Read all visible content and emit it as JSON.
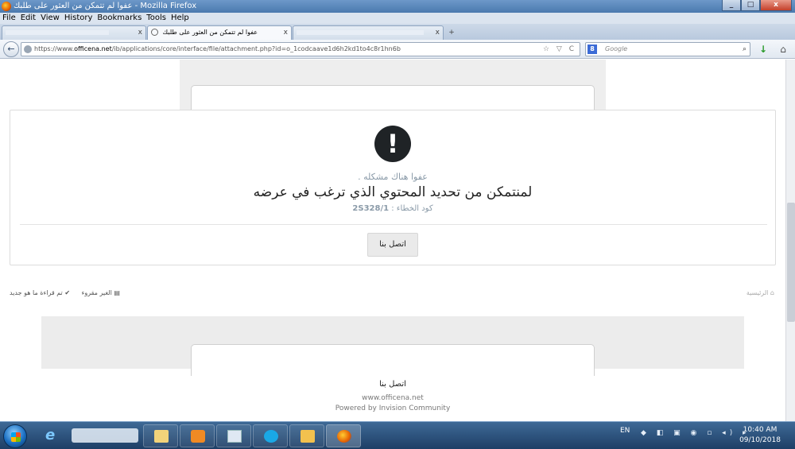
{
  "window": {
    "title": "عفوا لم تتمكن من العثور على طلبك - Mozilla Firefox",
    "controls": [
      "_",
      "□",
      "x"
    ]
  },
  "menu": [
    "File",
    "Edit",
    "View",
    "History",
    "Bookmarks",
    "Tools",
    "Help"
  ],
  "tabs": [
    {
      "label": ""
    },
    {
      "label": "عفوا لم تتمكن من العثور على طلبك"
    },
    {
      "label": ""
    }
  ],
  "tab_close": "x",
  "new_tab": "+",
  "nav": {
    "back": "←",
    "url_prefix": "https://www.",
    "url_domain": "officena.net",
    "url_path": "/ib/applications/core/interface/file/attachment.php?id=o_1codcaave1d6h2kd1to4c8r1hn6b",
    "url_icons": "☆ ▽ C",
    "search_engine": "8",
    "search_placeholder": "Google",
    "search_icon": "⌕",
    "download_icon": "↓",
    "home_icon": "⌂"
  },
  "error": {
    "icon": "!",
    "subtitle": "عفوا هناك مشكله .",
    "message": "لمنتمكن من تحديد المحتوي الذي ترغب في عرضه",
    "code_label": "كود الخطاء :",
    "code_value": "2S328/1",
    "contact_button": "اتصل بنا"
  },
  "footer_nav": {
    "mark_read": "✔ تم قراءة ما هو جديد",
    "unread": "▤ الغير مقروء",
    "home": "⌂ الرئيسية"
  },
  "footer": {
    "contact": "اتصل بنا",
    "site": "www.officena.net",
    "powered": "Powered by Invision Community"
  },
  "taskbar": {
    "lang": "EN",
    "tray_icons": "◆ ◧ ▣ ◉ ▫ ◂) ▸",
    "time": "10:40 AM",
    "date": "09/10/2018"
  }
}
